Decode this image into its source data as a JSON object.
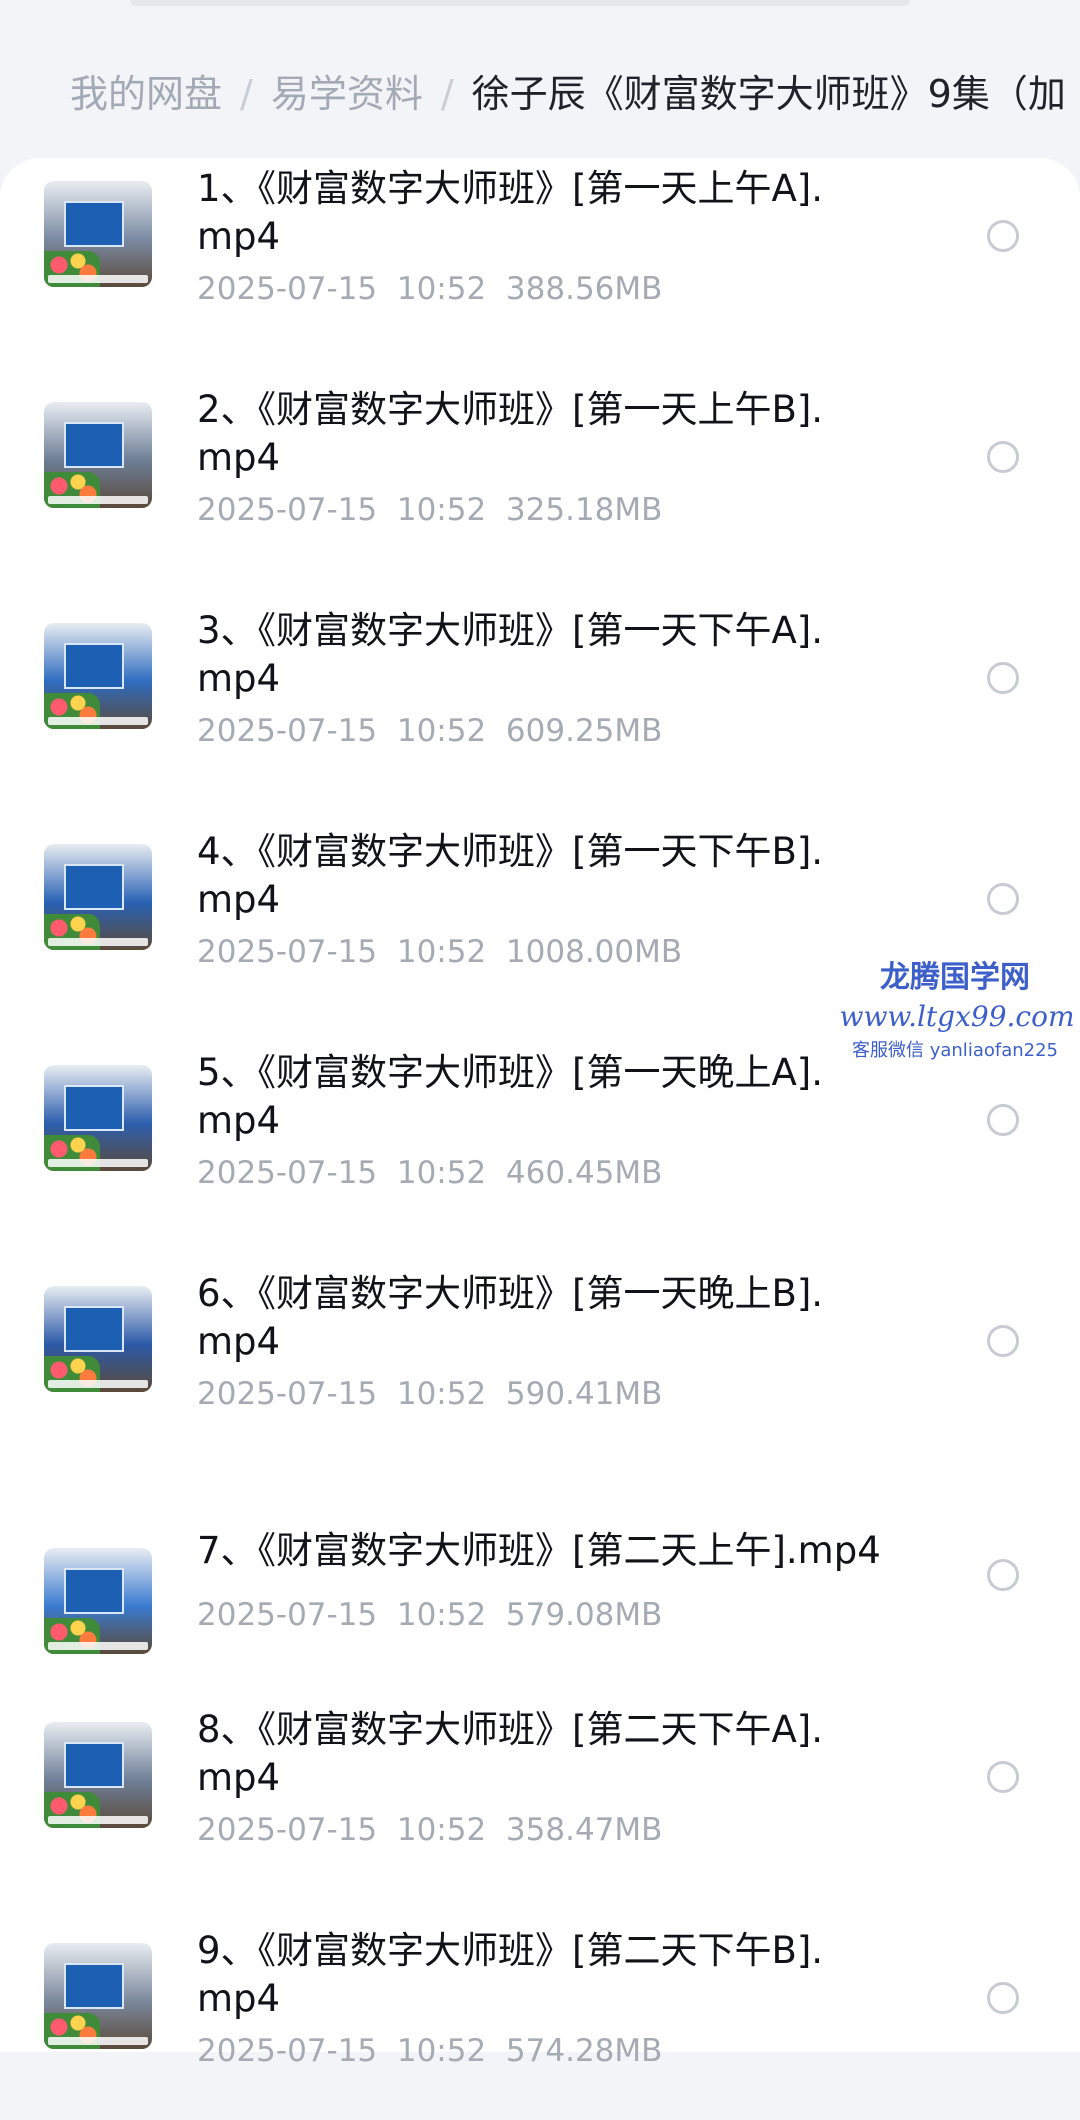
{
  "breadcrumb": {
    "items": [
      "我的网盘",
      "易学资料"
    ],
    "separator": "/",
    "current": "徐子辰《财富数字大师班》9集（加"
  },
  "files": [
    {
      "name": "1、《财富数字大师班》[第一天上午A].mp4",
      "date": "2025-07-15  10:52",
      "size": "388.56MB",
      "thumb_icon": "video-thumbnail-icon",
      "thumb_color": "#7a8aa3"
    },
    {
      "name": "2、《财富数字大师班》[第一天上午B].mp4",
      "date": "2025-07-15  10:52",
      "size": "325.18MB",
      "thumb_icon": "video-thumbnail-icon",
      "thumb_color": "#6d7e96"
    },
    {
      "name": "3、《财富数字大师班》[第一天下午A].mp4",
      "date": "2025-07-15  10:52",
      "size": "609.25MB",
      "thumb_icon": "video-thumbnail-icon",
      "thumb_color": "#2f6cc0"
    },
    {
      "name": "4、《财富数字大师班》[第一天下午B].mp4",
      "date": "2025-07-15  10:52",
      "size": "1008.00MB",
      "thumb_icon": "video-thumbnail-icon",
      "thumb_color": "#2a62b5"
    },
    {
      "name": "5、《财富数字大师班》[第一天晚上A].mp4",
      "date": "2025-07-15  10:52",
      "size": "460.45MB",
      "thumb_icon": "video-thumbnail-icon",
      "thumb_color": "#2d5fae"
    },
    {
      "name": "6、《财富数字大师班》[第一天晚上B].mp4",
      "date": "2025-07-15  10:52",
      "size": "590.41MB",
      "thumb_icon": "video-thumbnail-icon",
      "thumb_color": "#2c5aa8"
    },
    {
      "name": "7、《财富数字大师班》[第二天上午].mp4",
      "date": "2025-07-15  10:52",
      "size": "579.08MB",
      "thumb_icon": "video-thumbnail-icon",
      "thumb_color": "#3a7ad0"
    },
    {
      "name": "8、《财富数字大师班》[第二天下午A].mp4",
      "date": "2025-07-15  10:52",
      "size": "358.47MB",
      "thumb_icon": "video-thumbnail-icon",
      "thumb_color": "#6f7f97"
    },
    {
      "name": "9、《财富数字大师班》[第二天下午B].mp4",
      "date": "2025-07-15  10:52",
      "size": "574.28MB",
      "thumb_icon": "video-thumbnail-icon",
      "thumb_color": "#7b889c"
    }
  ],
  "watermark": {
    "title": "龙腾国学网",
    "url": "www.ltgx99.com",
    "contact": "客服微信 yanliaofan225"
  }
}
